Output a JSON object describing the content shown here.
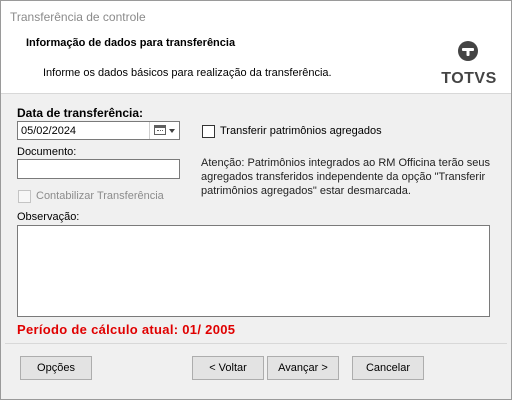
{
  "window": {
    "title": "Transferência de controle"
  },
  "header": {
    "title": "Informação de dados para transferência",
    "subtitle": "Informe os dados básicos para realização da transferência.",
    "logo_text": "TOTVS"
  },
  "form": {
    "date_label": "Data de transferência:",
    "date_value": "05/02/2024",
    "transfer_aggregates_label": "Transferir patrimônios agregados",
    "transfer_aggregates_checked": false,
    "document_label": "Documento:",
    "document_value": "",
    "accounting_label": "Contabilizar Transferência",
    "accounting_checked": false,
    "accounting_enabled": false,
    "note": "Atenção: Patrimônios integrados ao RM Officina terão seus agregados transferidos independente da opção \"Transferir patrimônios agregados\" estar desmarcada.",
    "observation_label": "Observação:",
    "observation_value": ""
  },
  "status": {
    "period_text": "Período de cálculo atual: 01/ 2005",
    "period_color": "#e00000"
  },
  "footer": {
    "options_label": "Opções",
    "back_label": "< Voltar",
    "next_label": "Avançar >",
    "cancel_label": "Cancelar"
  }
}
